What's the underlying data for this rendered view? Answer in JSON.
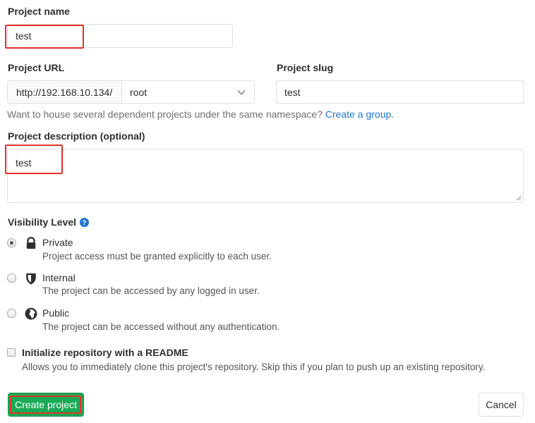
{
  "project_name": {
    "label": "Project name",
    "value": "test"
  },
  "project_url": {
    "label": "Project URL",
    "prefix": "http://192.168.10.134/",
    "namespace": "root"
  },
  "project_slug": {
    "label": "Project slug",
    "value": "test"
  },
  "namespace_help": {
    "text": "Want to house several dependent projects under the same namespace?",
    "link": "Create a group."
  },
  "project_description": {
    "label": "Project description (optional)",
    "value": "test"
  },
  "visibility": {
    "label": "Visibility Level",
    "selected": "Private",
    "options": [
      {
        "title": "Private",
        "desc": "Project access must be granted explicitly to each user.",
        "icon": "lock-icon"
      },
      {
        "title": "Internal",
        "desc": "The project can be accessed by any logged in user.",
        "icon": "shield-icon"
      },
      {
        "title": "Public",
        "desc": "The project can be accessed without any authentication.",
        "icon": "globe-icon"
      }
    ]
  },
  "readme": {
    "label": "Initialize repository with a README",
    "desc": "Allows you to immediately clone this project's repository. Skip this if you plan to push up an existing repository.",
    "checked": false
  },
  "actions": {
    "create": "Create project",
    "cancel": "Cancel"
  },
  "colors": {
    "primary_green": "#1aaa55",
    "link_blue": "#1f78d1",
    "highlight_red": "#e3332a"
  }
}
